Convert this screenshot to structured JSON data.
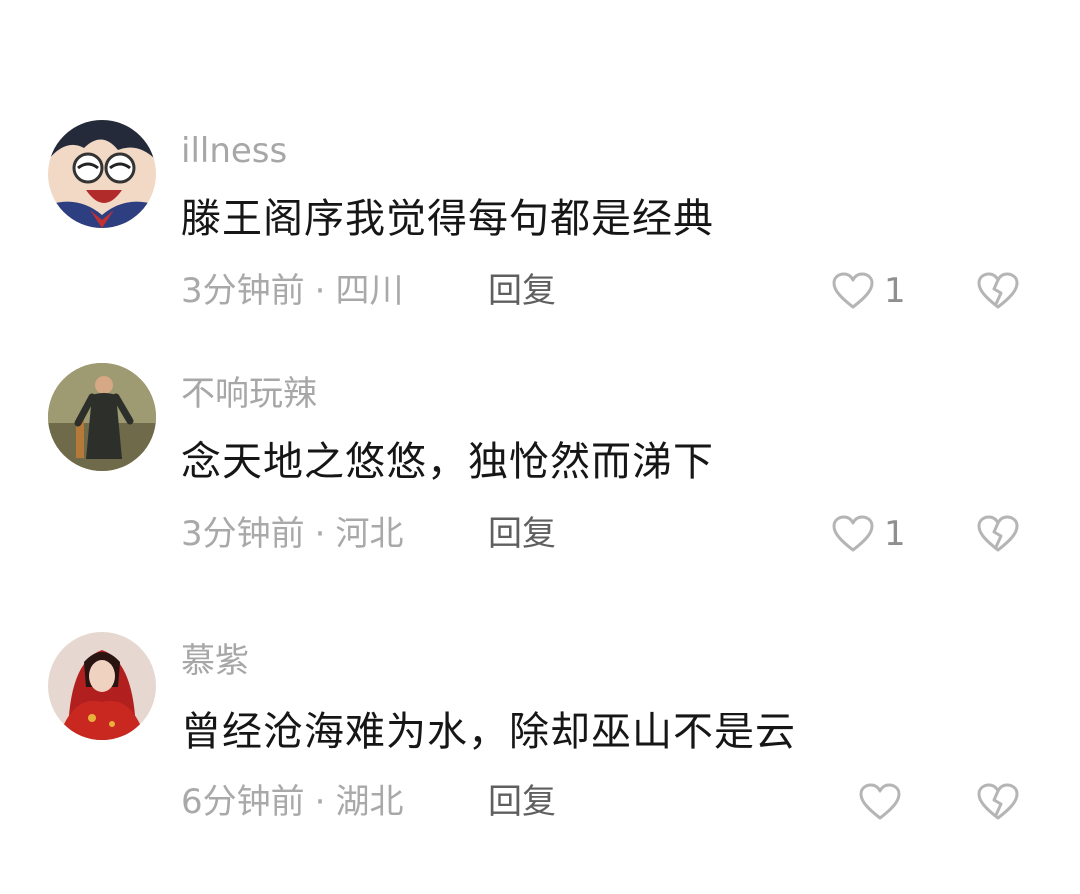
{
  "colors": {
    "username": "#a7a7a7",
    "text": "#161616",
    "meta": "#a9a9a9",
    "reply": "#5f5f5f",
    "icon": "#b5b5b5"
  },
  "comments": [
    {
      "username": "illness",
      "text": "滕王阁序我觉得每句都是经典",
      "time": "3分钟前",
      "location": "四川",
      "reply_label": "回复",
      "like_count": "1",
      "avatar_icon": "anime-character-avatar"
    },
    {
      "username": "不响玩辣",
      "text": "念天地之悠悠，独怆然而涕下",
      "time": "3分钟前",
      "location": "河北",
      "reply_label": "回复",
      "like_count": "1",
      "avatar_icon": "man-in-robe-avatar"
    },
    {
      "username": "慕紫",
      "text": "曾经沧海难为水，除却巫山不是云",
      "time": "6分钟前",
      "location": "湖北",
      "reply_label": "回复",
      "like_count": "",
      "avatar_icon": "woman-in-red-avatar"
    }
  ],
  "separator": "·"
}
